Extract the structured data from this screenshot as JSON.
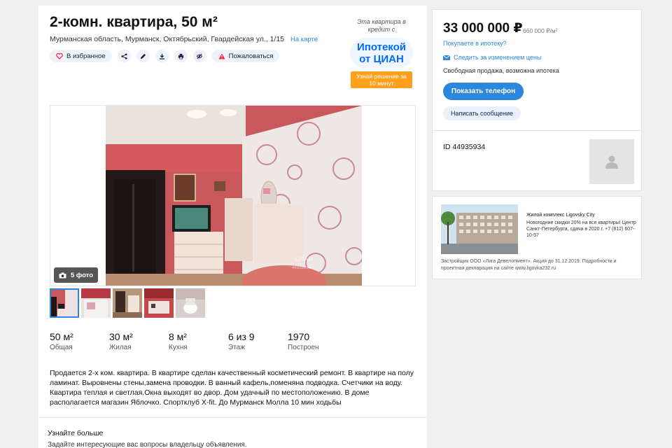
{
  "listing": {
    "title": "2-комн. квартира, 50 м²",
    "address": "Мурманская область, Мурманск, Октябрьский, Гвардейская ул., 1/15",
    "map_link": "На карте",
    "actions": {
      "favorite": "В избранное",
      "complain": "Пожаловаться"
    }
  },
  "promo": {
    "caption": "Эта квартира в кредит с",
    "logo": "Ипотекой от ЦИАН",
    "button": "Узнай решение за 10 минут"
  },
  "gallery": {
    "photo_count": "5 фото",
    "watermark": "ЦИАН",
    "watermark_id": "44935934"
  },
  "facts": [
    {
      "value": "50 м²",
      "label": "Общая"
    },
    {
      "value": "30 м²",
      "label": "Жилая"
    },
    {
      "value": "8 м²",
      "label": "Кухня"
    },
    {
      "value": "6 из 9",
      "label": "Этаж"
    },
    {
      "value": "1970",
      "label": "Построен"
    }
  ],
  "description": "Продается 2-х ком. квартира. В квартире сделан качественный косметический ремонт. В квартире на полу ламинат. Выровнены стены,замена проводки. В ванный кафель,поменяна подводка. Счетчики на воду. Квартира теплая и светлая.Окна выходят во двор. Дом удачный по местоположению. В доме располагается магазин Яблочко. Спортклуб X-fit. До Мурманск Молла 10 мин ходьбы",
  "more": {
    "title": "Узнайте больше",
    "text": "Задайте интересующие вас вопросы владельцу объявления."
  },
  "sidebar": {
    "price": "33 000 000 ₽",
    "price_per_m2": "660 000 ₽/м²",
    "mortgage_link": "Покупаете в ипотеку?",
    "watch_price": "Следить за изменением цены",
    "sale_type": "Свободная продажа, возможна ипотека",
    "show_phone": "Показать телефон",
    "write_message": "Написать сообщение",
    "object_id": "ID 44935934"
  },
  "ad": {
    "title": "Жилой комплекс Ligovsky City",
    "text": "Новогодние скидки 20% на все квартиры! Центр Санкт-Петербурга, сдача в 2020 г. +7 (812) 607-10-57",
    "footer": "Застройщик ООО «Лига Девелопмент». Акция до 31.12.2019. Подробности и проектная декларация на сайте www.ligovka232.ru"
  },
  "colors": {
    "accent": "#2b87db",
    "promo_orange": "#ff9f1c",
    "cian_blue": "#0468ff"
  }
}
